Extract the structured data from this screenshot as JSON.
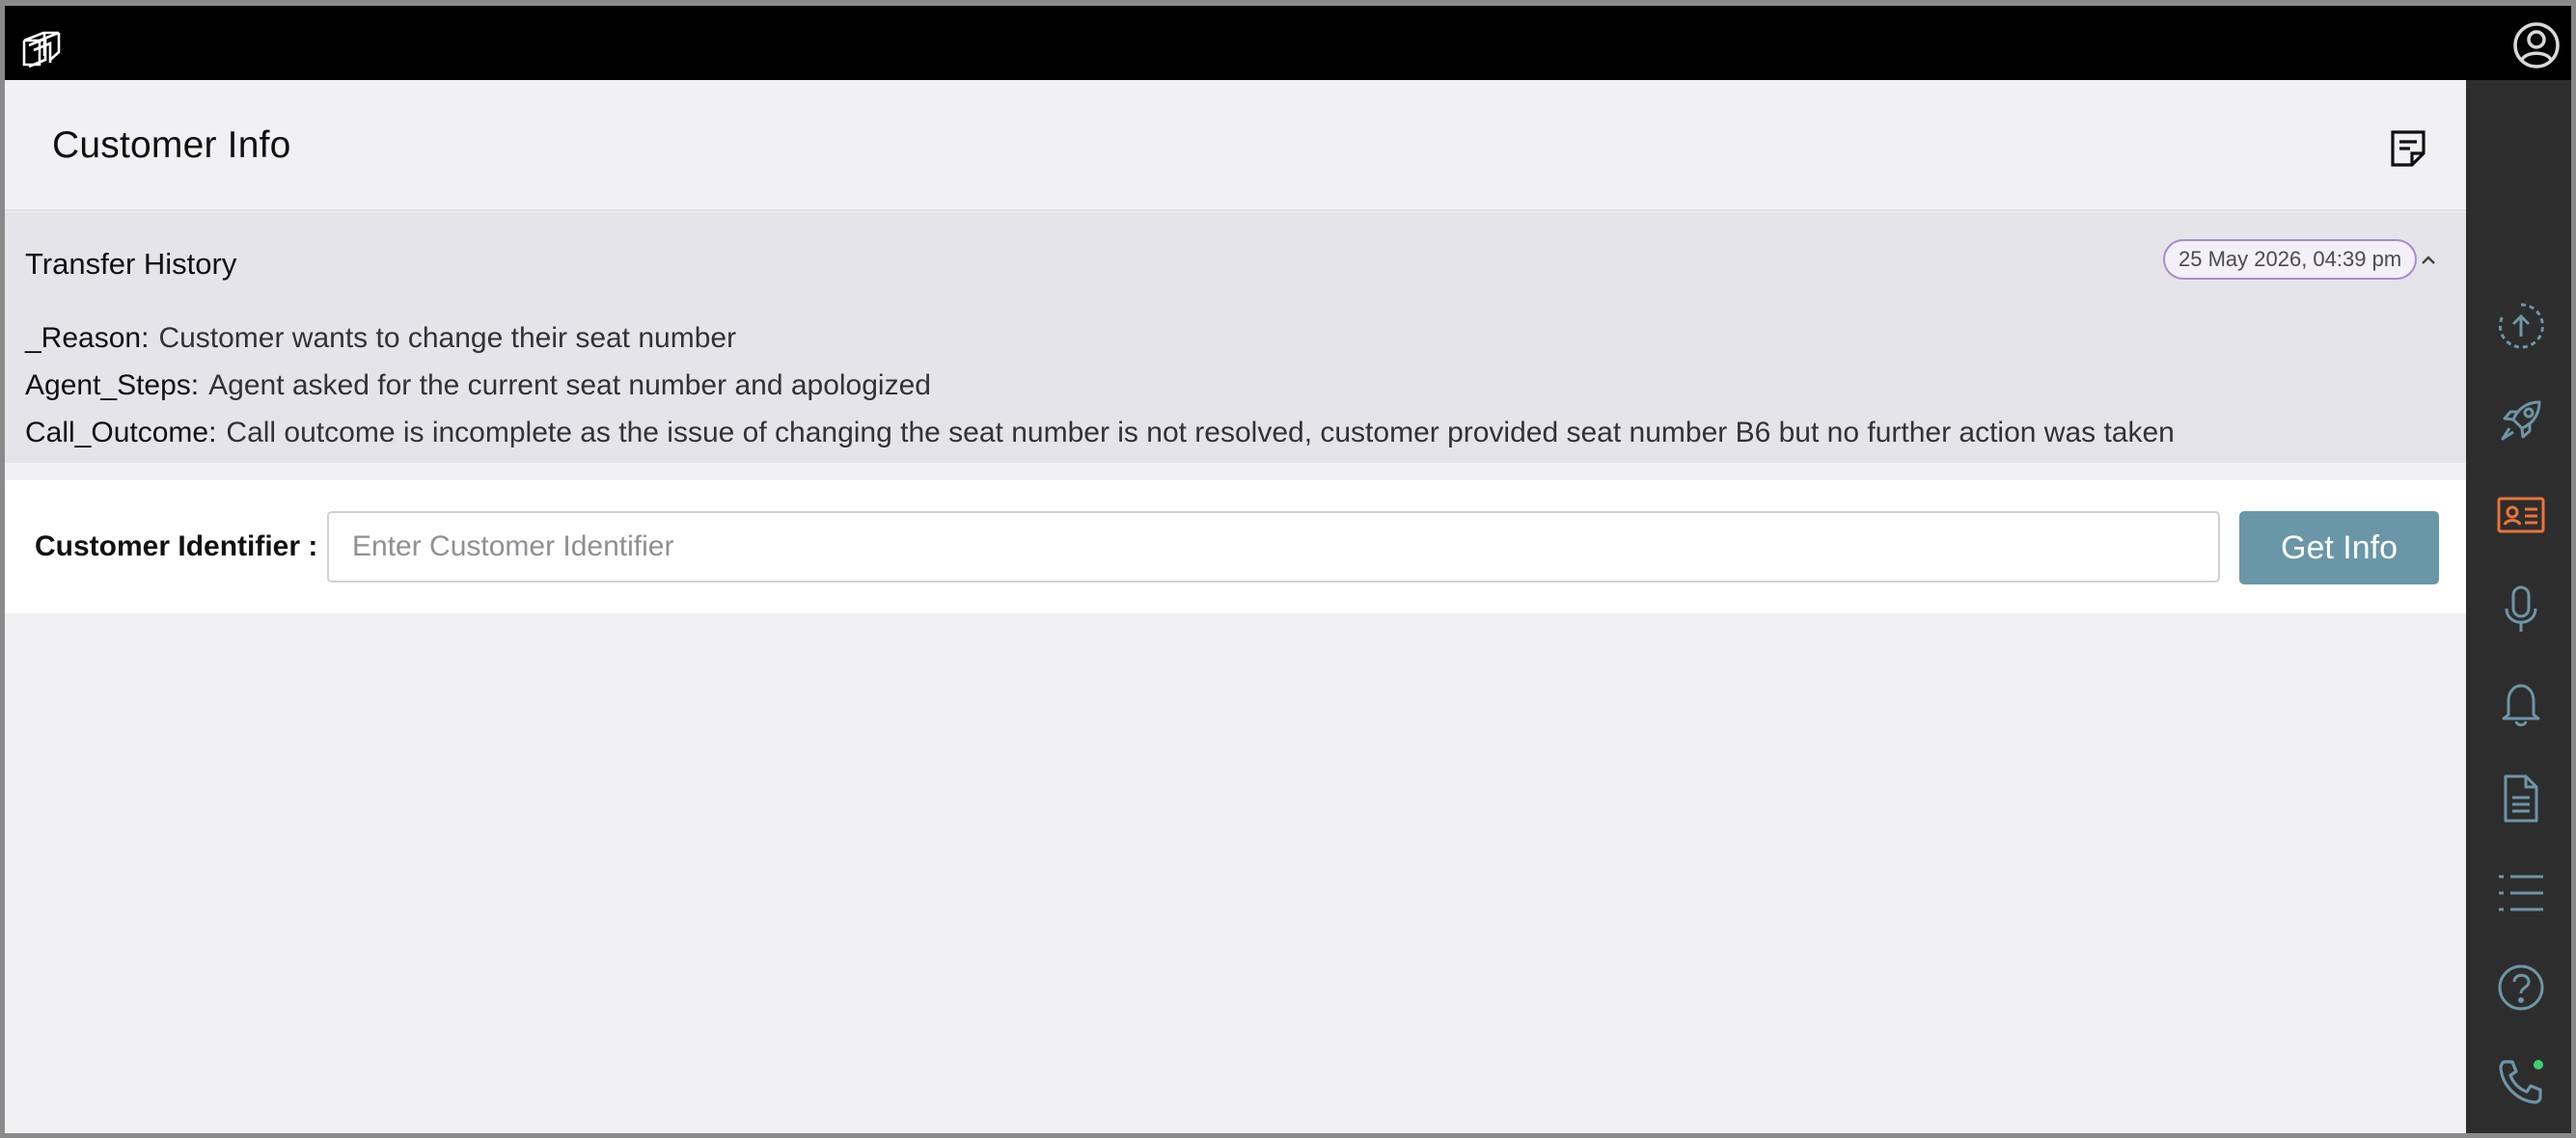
{
  "app": {
    "logo_icon": "stacked-squares-logo-icon",
    "user_icon": "user-circle-icon"
  },
  "header": {
    "title": "Customer Info",
    "notes_icon": "sticky-note-icon"
  },
  "transfer_history": {
    "title": "Transfer History",
    "date": "25 May 2026, 04:39 pm",
    "collapse_icon": "chevron-up-icon",
    "fields": [
      {
        "key": "_Reason:",
        "value": "Customer wants to change their seat number"
      },
      {
        "key": "Agent_Steps:",
        "value": "Agent asked for the current seat number and apologized"
      },
      {
        "key": "Call_Outcome:",
        "value": "Call outcome is incomplete as the issue of changing the seat number is not resolved, customer provided seat number B6 but no further action was taken"
      }
    ]
  },
  "lookup": {
    "label": "Customer Identifier :",
    "value": "",
    "placeholder": "Enter Customer Identifier",
    "button_label": "Get Info"
  },
  "sidebar": {
    "items": [
      {
        "icon": "upload-progress-icon",
        "active": false
      },
      {
        "icon": "rocket-icon",
        "active": false
      },
      {
        "icon": "id-card-icon",
        "active": true
      },
      {
        "icon": "microphone-icon",
        "active": false
      },
      {
        "icon": "bell-icon",
        "active": false
      },
      {
        "icon": "document-icon",
        "active": false
      },
      {
        "icon": "list-icon",
        "active": false
      },
      {
        "icon": "help-icon",
        "active": false
      },
      {
        "icon": "phone-icon",
        "active": false,
        "status_dot": true
      }
    ]
  },
  "colors": {
    "topbar": "#000000",
    "sidebar": "#2d2d2d",
    "icon_inactive": "#6d95a6",
    "icon_active": "#e9743a",
    "status_online": "#3ecf6e",
    "button": "#6a97a7",
    "badge_border": "#a98bd1"
  }
}
